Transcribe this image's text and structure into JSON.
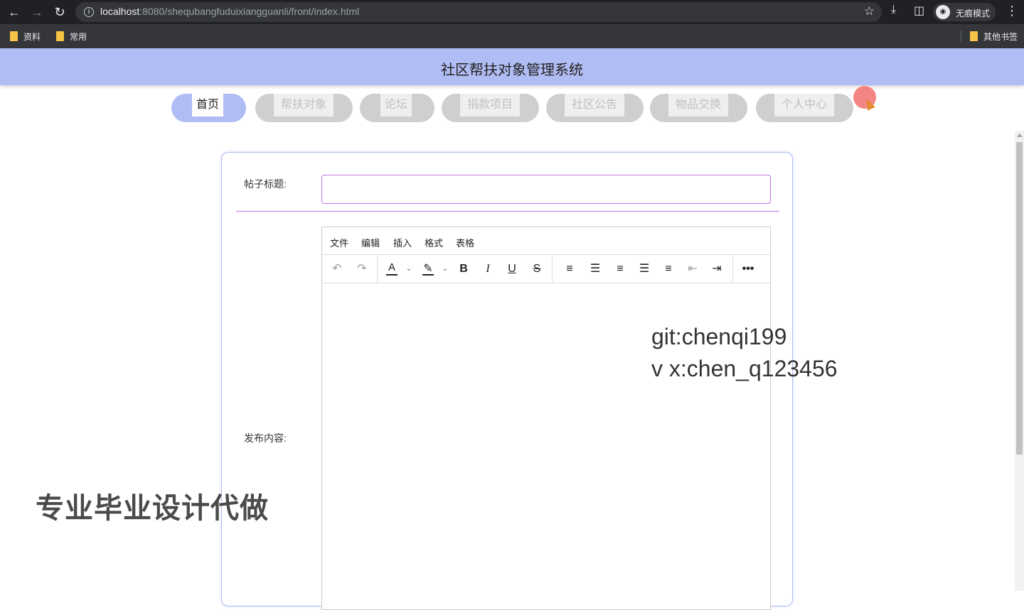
{
  "browser": {
    "url_host": "localhost",
    "url_rest": ":8080/shequbangfuduixiangguanli/front/index.html",
    "incognito_label": "无痕模式",
    "bookmarks": [
      "资料",
      "常用"
    ],
    "other_bookmarks": "其他书签",
    "icons": {
      "back": "arrow-left-icon",
      "forward": "arrow-right-icon",
      "reload": "reload-icon",
      "info": "info-icon",
      "star": "star-icon",
      "download": "download-icon",
      "sidepanel": "side-panel-icon",
      "incognito": "incognito-icon",
      "menu": "more-vert-icon"
    }
  },
  "app": {
    "title": "社区帮扶对象管理系统",
    "header_color": "#b0bcf4",
    "nav": [
      {
        "label": "首页",
        "active": true
      },
      {
        "label": "帮扶对象",
        "active": false
      },
      {
        "label": "论坛",
        "active": false
      },
      {
        "label": "捐款项目",
        "active": false
      },
      {
        "label": "社区公告",
        "active": false
      },
      {
        "label": "物品交换",
        "active": false
      },
      {
        "label": "个人中心",
        "active": false
      }
    ]
  },
  "form": {
    "title_label": "帖子标题:",
    "title_value": "",
    "content_label": "发布内容:",
    "border_color": "#c173e8"
  },
  "editor": {
    "menu": [
      "文件",
      "编辑",
      "插入",
      "格式",
      "表格"
    ],
    "toolbar": [
      "undo-icon",
      "redo-icon",
      "text-color-icon",
      "highlight-icon",
      "bold-icon",
      "italic-icon",
      "underline-icon",
      "strikethrough-icon",
      "line-height-icon",
      "align-left-icon",
      "align-center-icon",
      "align-right-icon",
      "align-justify-icon",
      "outdent-icon",
      "indent-icon",
      "more-icon"
    ]
  },
  "overlay": {
    "git_line": "git:chenqi199",
    "wechat_line": "v x:chen_q123456",
    "promo": "专业毕业设计代做"
  }
}
